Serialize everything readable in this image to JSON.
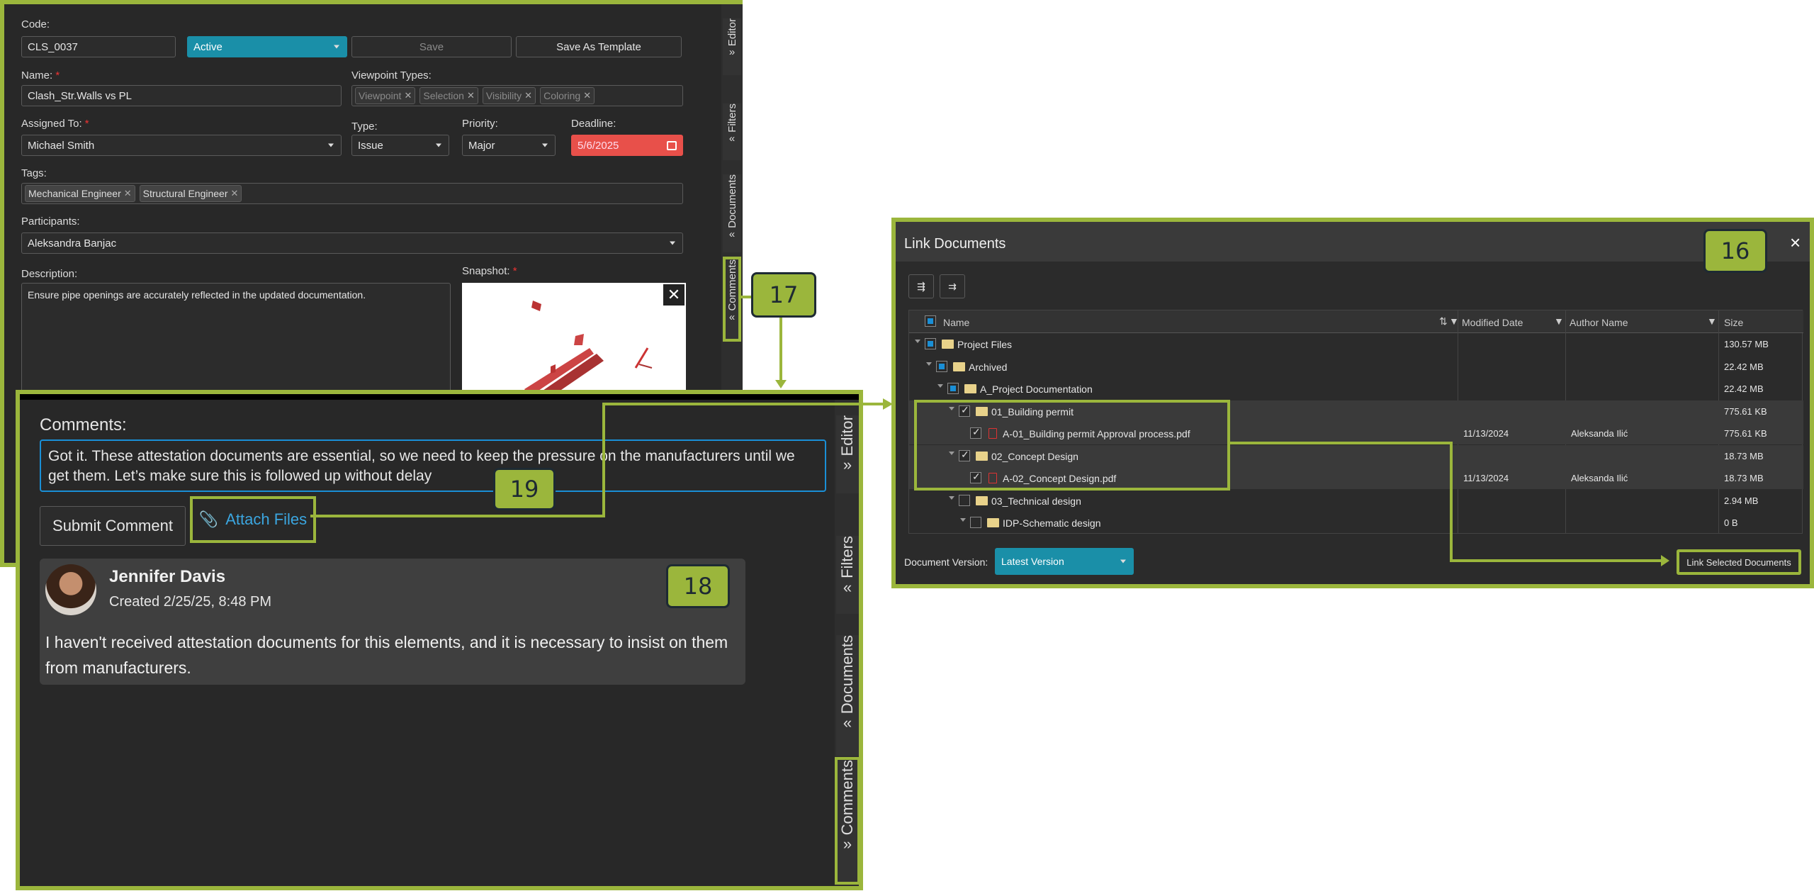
{
  "editor": {
    "code_label": "Code:",
    "code_value": "CLS_0037",
    "status_value": "Active",
    "save_label": "Save",
    "save_template_label": "Save As Template",
    "name_label": "Name:",
    "name_value": "Clash_Str.Walls vs PL",
    "viewpoint_label": "Viewpoint Types:",
    "viewpoint_chips": [
      "Viewpoint",
      "Selection",
      "Visibility",
      "Coloring"
    ],
    "assigned_label": "Assigned To:",
    "assigned_value": "Michael Smith",
    "type_label": "Type:",
    "type_value": "Issue",
    "priority_label": "Priority:",
    "priority_value": "Major",
    "deadline_label": "Deadline:",
    "deadline_value": "5/6/2025",
    "tags_label": "Tags:",
    "tags": [
      "Mechanical Engineer",
      "Structural Engineer"
    ],
    "participants_label": "Participants:",
    "participants_value": "Aleksandra Banjac",
    "description_label": "Description:",
    "description_value": "Ensure pipe openings are accurately reflected in the updated documentation.",
    "snapshot_label": "Snapshot:",
    "required_mark": "*",
    "side_tabs": [
      "Editor",
      "Filters",
      "Documents",
      "Comments"
    ]
  },
  "comments": {
    "heading": "Comments:",
    "draft_text": "Got it. These attestation documents are essential, so we need to keep the pressure on the manufacturers until we get them. Let’s make sure this is followed up without delay",
    "submit_label": "Submit Comment",
    "attach_label": "Attach Files",
    "entry": {
      "author": "Jennifer Davis",
      "created": "Created 2/25/25, 8:48 PM",
      "text": "I haven't received attestation documents for this elements, and it is necessary to insist on them from manufacturers."
    },
    "side_tabs": [
      "Editor",
      "Filters",
      "Documents",
      "Comments"
    ]
  },
  "link_documents": {
    "title": "Link Documents",
    "close_glyph": "×",
    "columns": [
      "Name",
      "Modified Date",
      "Author Name",
      "Size"
    ],
    "rows": [
      {
        "name": "Project Files",
        "modified": "",
        "author": "",
        "size": "130.57 MB",
        "level": 0,
        "kind": "folder",
        "check": "part",
        "selected": false
      },
      {
        "name": "Archived",
        "modified": "",
        "author": "",
        "size": "22.42 MB",
        "level": 1,
        "kind": "folder",
        "check": "part",
        "selected": false
      },
      {
        "name": "A_Project Documentation",
        "modified": "",
        "author": "",
        "size": "22.42 MB",
        "level": 2,
        "kind": "folder",
        "check": "part",
        "selected": false
      },
      {
        "name": "01_Building permit",
        "modified": "",
        "author": "",
        "size": "775.61 KB",
        "level": 3,
        "kind": "folder",
        "check": "chk",
        "selected": true
      },
      {
        "name": "A-01_Building permit Approval process.pdf",
        "modified": "11/13/2024",
        "author": "Aleksanda Ilić",
        "size": "775.61 KB",
        "level": 4,
        "kind": "pdf",
        "check": "chk",
        "selected": true
      },
      {
        "name": "02_Concept Design",
        "modified": "",
        "author": "",
        "size": "18.73 MB",
        "level": 3,
        "kind": "folder",
        "check": "chk",
        "selected": true
      },
      {
        "name": "A-02_Concept Design.pdf",
        "modified": "11/13/2024",
        "author": "Aleksanda Ilić",
        "size": "18.73 MB",
        "level": 4,
        "kind": "pdf",
        "check": "chk",
        "selected": true
      },
      {
        "name": "03_Technical design",
        "modified": "",
        "author": "",
        "size": "2.94 MB",
        "level": 3,
        "kind": "folder",
        "check": "none",
        "selected": false
      },
      {
        "name": "IDP-Schematic design",
        "modified": "",
        "author": "",
        "size": "0 B",
        "level": 4,
        "kind": "folder",
        "check": "none",
        "selected": false
      }
    ],
    "version_label": "Document Version:",
    "version_value": "Latest Version",
    "link_button_label": "Link Selected Documents"
  },
  "callouts": [
    "16",
    "17",
    "18",
    "19"
  ],
  "colors": {
    "accent": "#9bb63c",
    "teal": "#1a8fa8",
    "deadline": "#e8504a",
    "panel": "#282828"
  }
}
